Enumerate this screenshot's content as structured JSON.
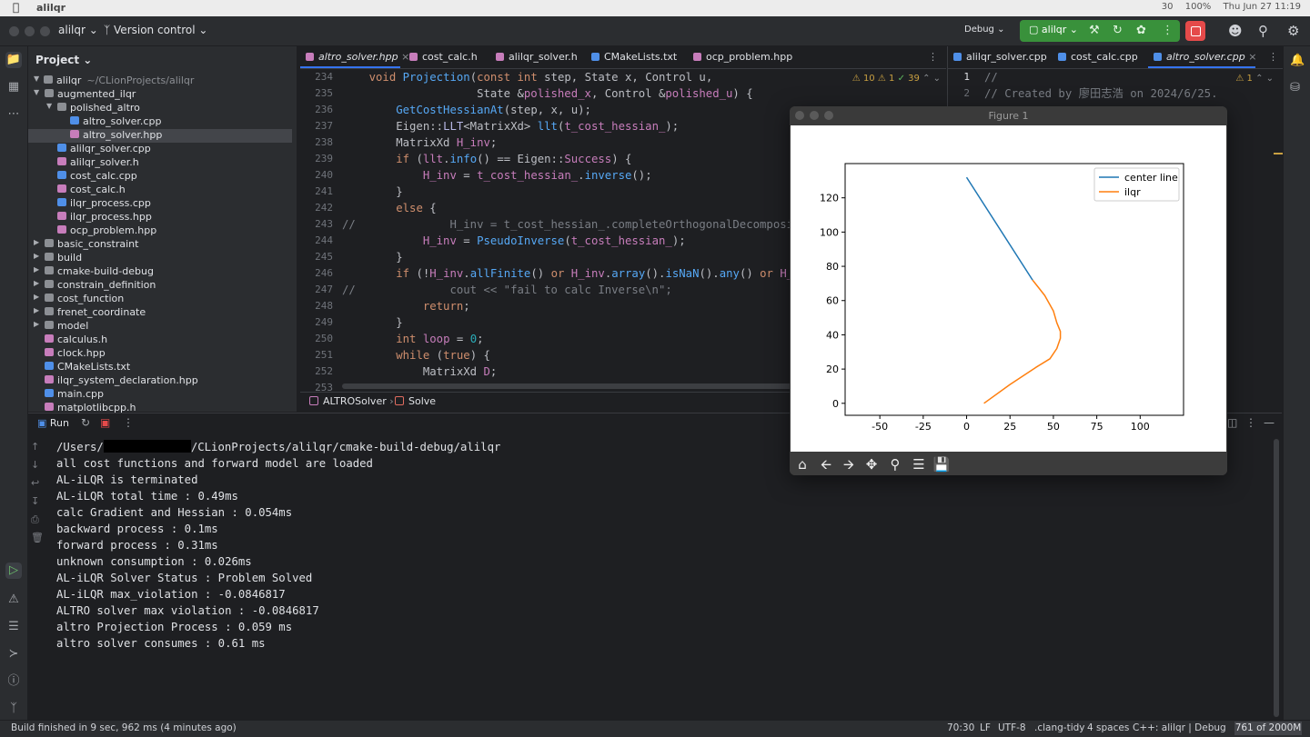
{
  "mac_menu": {
    "app_name": "alilqr",
    "status": [
      "30",
      "100%",
      "Thu Jun 27  11:19"
    ]
  },
  "toolbar": {
    "project_switcher": "alilqr",
    "version_control": "Version control",
    "build_type": "Debug",
    "run_config": "alilqr"
  },
  "project_panel": {
    "title": "Project",
    "root": "alilqr",
    "root_path": "~/CLionProjects/alilqr",
    "items": [
      {
        "label": "augmented_ilqr",
        "kind": "folder",
        "open": true
      },
      {
        "label": "polished_altro",
        "kind": "folder",
        "open": true
      },
      {
        "label": "altro_solver.cpp",
        "kind": "cpp"
      },
      {
        "label": "altro_solver.hpp",
        "kind": "hpp"
      },
      {
        "label": "alilqr_solver.cpp",
        "kind": "cpp"
      },
      {
        "label": "alilqr_solver.h",
        "kind": "h"
      },
      {
        "label": "cost_calc.cpp",
        "kind": "cpp"
      },
      {
        "label": "cost_calc.h",
        "kind": "h"
      },
      {
        "label": "ilqr_process.cpp",
        "kind": "cpp"
      },
      {
        "label": "ilqr_process.hpp",
        "kind": "hpp"
      },
      {
        "label": "ocp_problem.hpp",
        "kind": "hpp"
      },
      {
        "label": "basic_constraint",
        "kind": "folder"
      },
      {
        "label": "build",
        "kind": "folder"
      },
      {
        "label": "cmake-build-debug",
        "kind": "folder"
      },
      {
        "label": "constrain_definition",
        "kind": "folder"
      },
      {
        "label": "cost_function",
        "kind": "folder"
      },
      {
        "label": "frenet_coordinate",
        "kind": "folder"
      },
      {
        "label": "model",
        "kind": "folder"
      },
      {
        "label": "calculus.h",
        "kind": "h"
      },
      {
        "label": "clock.hpp",
        "kind": "hpp"
      },
      {
        "label": "CMakeLists.txt",
        "kind": "cmake"
      },
      {
        "label": "ilqr_system_declaration.hpp",
        "kind": "hpp"
      },
      {
        "label": "main.cpp",
        "kind": "cpp"
      },
      {
        "label": "matplotlibcpp.h",
        "kind": "h"
      }
    ]
  },
  "editor_tabs": [
    {
      "label": "altro_solver.hpp",
      "active": true
    },
    {
      "label": "cost_calc.h",
      "active": false
    },
    {
      "label": "alilqr_solver.h",
      "active": false
    },
    {
      "label": "CMakeLists.txt",
      "active": false
    },
    {
      "label": "ocp_problem.hpp",
      "active": false
    }
  ],
  "inspection": {
    "warnings": "10",
    "weak": "1",
    "ok": "39"
  },
  "line_numbers": [
    "234",
    "235",
    "236",
    "237",
    "238",
    "239",
    "240",
    "241",
    "242",
    "243",
    "244",
    "245",
    "246",
    "247",
    "248",
    "249",
    "250",
    "251",
    "252",
    "253"
  ],
  "breadcrumb": {
    "class": "ALTROSolver",
    "method": "Solve"
  },
  "editor2": {
    "tabs": [
      {
        "label": "alilqr_solver.cpp",
        "active": false
      },
      {
        "label": "cost_calc.cpp",
        "active": false
      },
      {
        "label": "altro_solver.cpp",
        "active": true
      }
    ],
    "inspection": "1",
    "line_numbers": [
      "1",
      "2"
    ],
    "lines": [
      "//",
      "// Created by 廖田志浩 on 2024/6/25."
    ]
  },
  "run_panel": {
    "title": "Run",
    "path_prefix": "/Users/",
    "path_suffix": "/CLionProjects/alilqr/cmake-build-debug/alilqr",
    "output": [
      "all cost functions and forward model are loaded",
      "AL-iLQR is terminated",
      "AL-iLQR total time : 0.49ms",
      "calc Gradient and Hessian : 0.054ms",
      "backward process : 0.1ms",
      "forward process : 0.31ms",
      "unknown consumption : 0.026ms",
      "AL-iLQR Solver Status : Problem Solved",
      "AL-iLQR max_violation : -0.0846817",
      "ALTRO solver max violation : -0.0846817",
      "altro Projection Process : 0.059 ms",
      "altro solver consumes : 0.61 ms"
    ]
  },
  "statusbar": {
    "message": "Build finished in 9 sec, 962 ms (4 minutes ago)",
    "position": "70:30",
    "line_sep": "LF",
    "encoding": "UTF-8",
    "linter": ".clang-tidy",
    "indent": "4 spaces",
    "context": "C++: alilqr | Debug",
    "memory": "761 of 2000M"
  },
  "figure": {
    "title": "Figure 1",
    "tools": [
      "home-icon",
      "back-icon",
      "forward-icon",
      "pan-icon",
      "zoom-icon",
      "configure-icon",
      "save-icon"
    ]
  },
  "colors": {
    "center_line": "#1f77b4",
    "ilqr": "#ff7f0e",
    "accent": "#3574f0",
    "run_green": "#39913b"
  },
  "chart_data": {
    "type": "line",
    "title": "",
    "xlabel": "",
    "ylabel": "",
    "xlim": [
      -70,
      125
    ],
    "ylim": [
      -7,
      140
    ],
    "xticks": [
      -50,
      -25,
      0,
      25,
      50,
      75,
      100
    ],
    "yticks": [
      0,
      20,
      40,
      60,
      80,
      100,
      120
    ],
    "grid": false,
    "legend_position": "top-right",
    "series": [
      {
        "name": "center line",
        "x": [
          0,
          38
        ],
        "y": [
          132,
          72
        ]
      },
      {
        "name": "ilqr",
        "x": [
          10,
          25,
          40,
          48,
          52,
          54,
          54,
          52,
          50,
          45,
          38
        ],
        "y": [
          0,
          11,
          21,
          26,
          32,
          38,
          42,
          47,
          54,
          63,
          72
        ]
      }
    ]
  }
}
